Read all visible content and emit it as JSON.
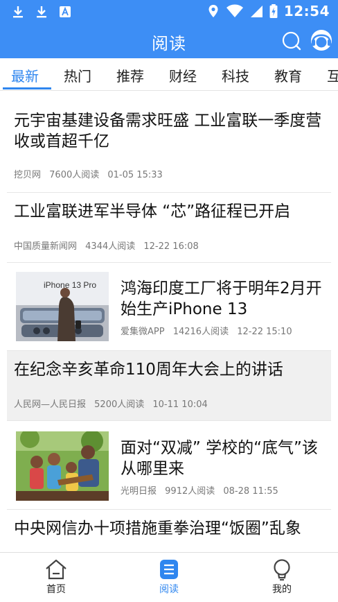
{
  "status_bar": {
    "time": "12:54",
    "left_icons": [
      "download-icon",
      "download-icon",
      "text-notification-icon"
    ],
    "right_icons": [
      "location-icon",
      "wifi-icon",
      "signal-icon",
      "battery-charging-icon"
    ]
  },
  "app_bar": {
    "title": "阅读",
    "right_icons": [
      "search-icon",
      "customer-service-icon"
    ]
  },
  "tabs": [
    {
      "label": "最新",
      "active": true
    },
    {
      "label": "热门"
    },
    {
      "label": "推荐"
    },
    {
      "label": "财经"
    },
    {
      "label": "科技"
    },
    {
      "label": "教育"
    },
    {
      "label": "互"
    }
  ],
  "feed": [
    {
      "title": "元宇宙基建设备需求旺盛 工业富联一季度营收或首超千亿",
      "source": "挖贝网",
      "reads": "7600人阅读",
      "time": "01-05 15:33"
    },
    {
      "title": "工业富联进军半导体 “芯”路征程已开启",
      "source": "中国质量新闻网",
      "reads": "4344人阅读",
      "time": "12-22 16:08"
    },
    {
      "title": "鸿海印度工厂将于明年2月开始生产iPhone 13",
      "source": "爱集微APP",
      "reads": "14216人阅读",
      "time": "12-22 15:10",
      "thumb_text": "iPhone 13 Pro"
    },
    {
      "title": "在纪念辛亥革命110周年大会上的讲话",
      "source": "人民网—人民日报",
      "reads": "5200人阅读",
      "time": "10-11 10:04"
    },
    {
      "title": "面对“双减” 学校的“底气”该从哪里来",
      "source": "光明日报",
      "reads": "9912人阅读",
      "time": "08-28 11:55"
    },
    {
      "title": "中央网信办十项措施重拳治理“饭圈”乱象"
    }
  ],
  "bottom_nav": [
    {
      "label": "首页",
      "icon": "home-icon"
    },
    {
      "label": "阅读",
      "icon": "reading-icon",
      "active": true
    },
    {
      "label": "我的",
      "icon": "profile-bulb-icon"
    }
  ],
  "colors": {
    "brand_blue": "#3d8ef5",
    "active_blue": "#2f86ef",
    "meta_gray": "#777777"
  }
}
